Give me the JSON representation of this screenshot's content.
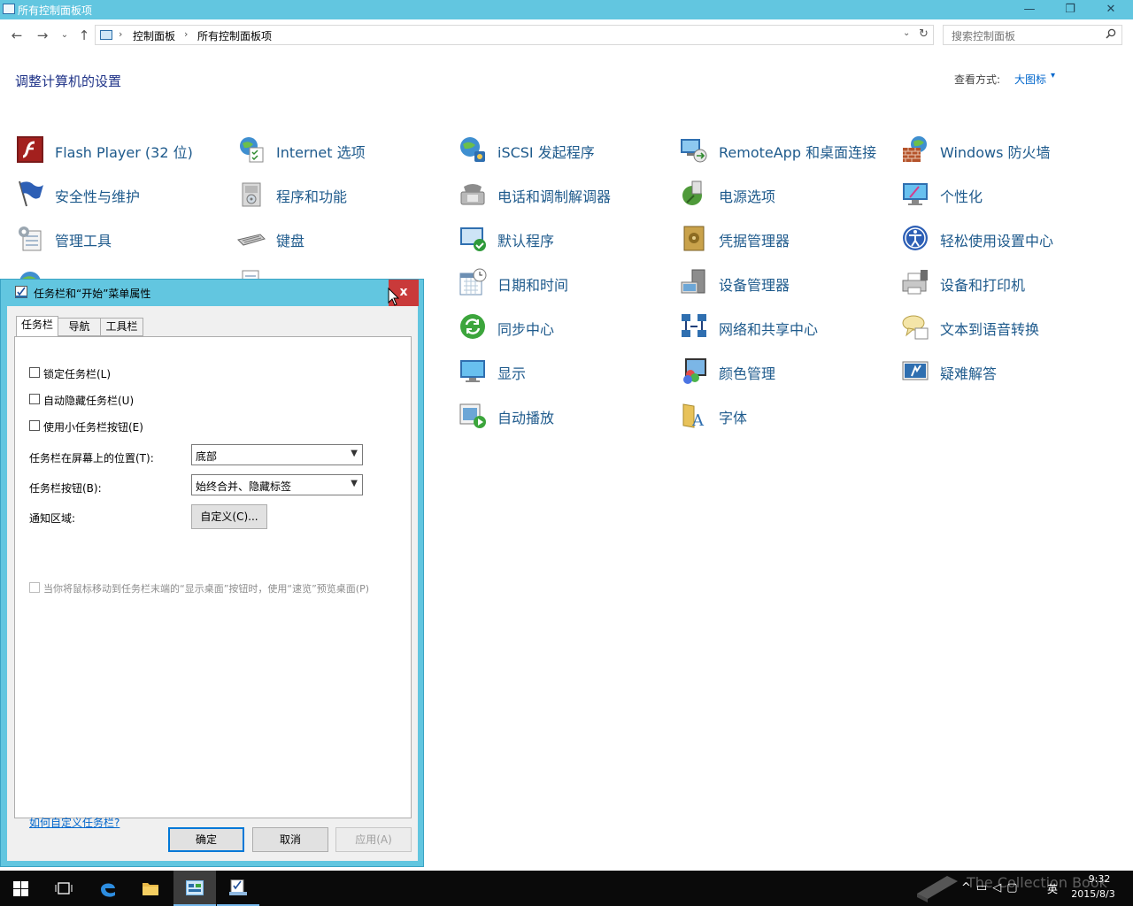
{
  "window": {
    "title": "所有控制面板项",
    "minimize": "—",
    "maximize": "❐",
    "close": "✕"
  },
  "nav": {
    "back": "←",
    "forward": "→",
    "recent": "⌄",
    "up": "↑"
  },
  "address": {
    "crumbs": [
      "控制面板",
      "所有控制面板项"
    ],
    "separator": "›",
    "dropdown": "⌄",
    "refresh": "↻"
  },
  "search": {
    "placeholder": "搜索控制面板",
    "icon": "search-icon"
  },
  "header": {
    "title": "调整计算机的设置",
    "view_by_label": "查看方式:",
    "view_by_value": "大图标"
  },
  "items": {
    "flash": "Flash Player (32 位)",
    "internet": "Internet 选项",
    "iscsi": "iSCSI 发起程序",
    "remoteapp": "RemoteApp 和桌面连接",
    "firewall": "Windows 防火墙",
    "security": "安全性与维护",
    "programs": "程序和功能",
    "phone": "电话和调制解调器",
    "power": "电源选项",
    "personalize": "个性化",
    "admin": "管理工具",
    "keyboard": "键盘",
    "defaults": "默认程序",
    "credentials": "凭据管理器",
    "ease": "轻松使用设置中心",
    "datetime": "日期和时间",
    "devmgr": "设备管理器",
    "printers": "设备和打印机",
    "sync": "同步中心",
    "network": "网络和共享中心",
    "tts": "文本到语音转换",
    "display": "显示",
    "color": "颜色管理",
    "troubleshoot": "疑难解答",
    "autoplay": "自动播放",
    "fonts": "字体"
  },
  "dialog": {
    "title": "任务栏和“开始”菜单属性",
    "close": "x",
    "tabs": [
      "任务栏",
      "导航",
      "工具栏"
    ],
    "lock": "锁定任务栏(L)",
    "autohide": "自动隐藏任务栏(U)",
    "small": "使用小任务栏按钮(E)",
    "position_label": "任务栏在屏幕上的位置(T):",
    "position_value": "底部",
    "buttons_label": "任务栏按钮(B):",
    "buttons_value": "始终合并、隐藏标签",
    "notify_label": "通知区域:",
    "customize": "自定义(C)...",
    "peek": "当你将鼠标移动到任务栏末端的“显示桌面”按钮时，使用“速览”预览桌面(P)",
    "help_link": "如何自定义任务栏?",
    "ok": "确定",
    "cancel": "取消",
    "apply": "应用(A)"
  },
  "taskbar": {
    "ime": "英",
    "time": "9:32",
    "date": "2015/8/3",
    "watermark": "The Collection Book"
  },
  "colors": {
    "titlebar": "#62c6e0",
    "link": "#1e5a8c",
    "accent": "#0078d7",
    "close_red": "#c93a3a"
  }
}
